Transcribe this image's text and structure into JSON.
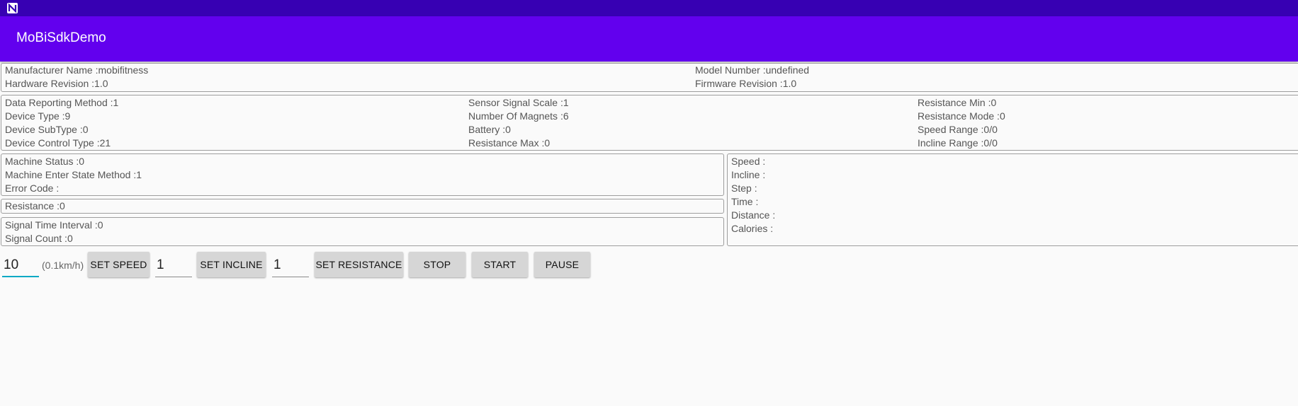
{
  "app": {
    "title": "MoBiSdkDemo"
  },
  "device_info": {
    "manufacturer": "Manufacturer Name :mobifitness",
    "hardware": "Hardware Revision :1.0",
    "model": "Model Number :undefined",
    "firmware": "Firmware Revision :1.0"
  },
  "config": {
    "col1": [
      "Data Reporting Method :1",
      "Device Type :9",
      "Device SubType :0",
      "Device Control Type :21"
    ],
    "col2": [
      "Sensor Signal Scale :1",
      "Number Of Magnets :6",
      "Battery :0",
      "Resistance Max :0"
    ],
    "col3": [
      "Resistance Min :0",
      "Resistance Mode :0",
      "Speed Range :0/0",
      "Incline Range :0/0"
    ]
  },
  "machine": [
    "Machine Status :0",
    "Machine Enter State Method :1",
    "Error Code :"
  ],
  "resistance": "Resistance :0",
  "signal": [
    "Signal Time Interval :0",
    "Signal Count :0"
  ],
  "metrics": [
    "Speed :",
    "Incline :",
    "Step :",
    "Time :",
    "Distance :",
    "Calories :"
  ],
  "controls": {
    "speed_value": "10",
    "speed_unit": "(0.1km/h)",
    "set_speed": "SET SPEED",
    "incline_value": "1",
    "set_incline": "SET INCLINE",
    "resistance_value": "1",
    "set_resistance": "SET RESISTANCE",
    "stop": "STOP",
    "start": "START",
    "pause": "PAUSE"
  }
}
